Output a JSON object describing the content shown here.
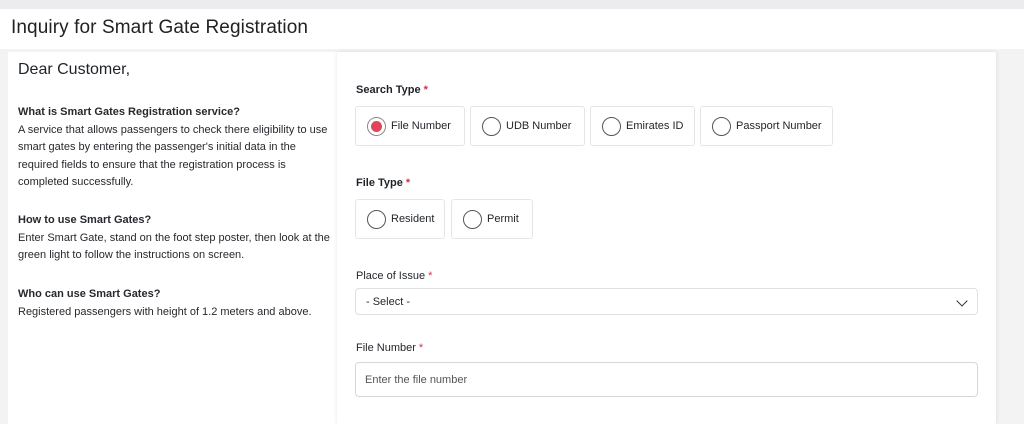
{
  "page": {
    "title": "Inquiry for Smart Gate Registration"
  },
  "info": {
    "greeting": "Dear Customer,",
    "sections": [
      {
        "question": "What is Smart Gates Registration service?",
        "answer": "A service that allows passengers to check there eligibility to use smart gates by entering the passenger's initial data in the required fields to ensure that the registration process is completed successfully."
      },
      {
        "question": "How to use Smart Gates?",
        "answer": "Enter Smart Gate, stand on the foot step poster, then look at the green light to follow the instructions on screen."
      },
      {
        "question": "Who can use Smart Gates?",
        "answer": "Registered passengers with height of 1.2 meters and above."
      }
    ]
  },
  "form": {
    "required_marker": "*",
    "accent_color": "#e24559",
    "search_type": {
      "label": "Search Type",
      "options": [
        "File Number",
        "UDB Number",
        "Emirates ID",
        "Passport Number"
      ],
      "selected": "File Number"
    },
    "file_type": {
      "label": "File Type",
      "options": [
        "Resident",
        "Permit"
      ],
      "selected": null
    },
    "place_of_issue": {
      "label": "Place of Issue",
      "value": "- Select -",
      "icon": "chevron-down-icon"
    },
    "file_number": {
      "label": "File Number",
      "value": "",
      "placeholder": "Enter the file number"
    }
  }
}
